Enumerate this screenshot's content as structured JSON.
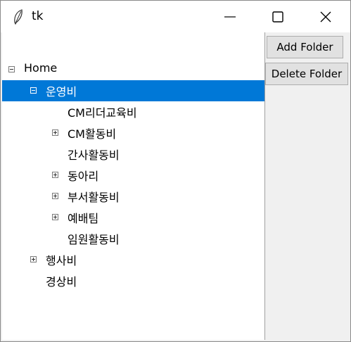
{
  "window": {
    "title": "tk"
  },
  "controls": {
    "minimize": "minimize",
    "maximize": "maximize",
    "close": "close"
  },
  "buttons": {
    "add_folder": "Add Folder",
    "delete_folder": "Delete Folder"
  },
  "tree": {
    "items": [
      {
        "label": "Home",
        "level": 0,
        "expander": "minus",
        "selected": false
      },
      {
        "label": "운영비",
        "level": 1,
        "expander": "minus",
        "selected": true
      },
      {
        "label": "CM리더교육비",
        "level": 2,
        "expander": "none",
        "selected": false
      },
      {
        "label": "CM활동비",
        "level": 2,
        "expander": "plus",
        "selected": false
      },
      {
        "label": "간사활동비",
        "level": 2,
        "expander": "none",
        "selected": false
      },
      {
        "label": "동아리",
        "level": 2,
        "expander": "plus",
        "selected": false
      },
      {
        "label": "부서활동비",
        "level": 2,
        "expander": "plus",
        "selected": false
      },
      {
        "label": "예배팀",
        "level": 2,
        "expander": "plus",
        "selected": false
      },
      {
        "label": "임원활동비",
        "level": 2,
        "expander": "none",
        "selected": false
      },
      {
        "label": "행사비",
        "level": 1,
        "expander": "plus",
        "selected": false
      },
      {
        "label": "경상비",
        "level": 1,
        "expander": "none",
        "selected": false
      }
    ]
  },
  "colors": {
    "selection": "#0078d7",
    "background": "#f0f0f0",
    "tree_background": "#ffffff"
  }
}
